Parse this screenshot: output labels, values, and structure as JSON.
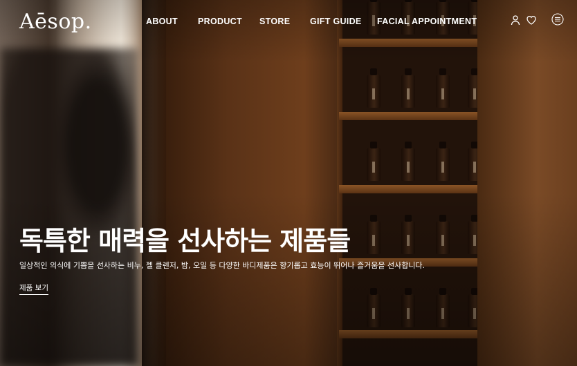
{
  "brand": {
    "logo_text": "Aēsop."
  },
  "nav": {
    "items": [
      {
        "label": "ABOUT"
      },
      {
        "label": "PRODUCT"
      },
      {
        "label": "STORE"
      },
      {
        "label": "GIFT GUIDE"
      },
      {
        "label": "FACIAL APPOINTMENT"
      }
    ]
  },
  "header_icons": [
    "user-icon",
    "heart-icon",
    "menu-icon"
  ],
  "hero": {
    "headline": "독특한 매력을 선사하는 제품들",
    "subline": "일상적인 의식에 기쁨을 선사하는 비누, 젤 클렌저, 밤, 오일 등 다양한 바디제품은 향기롭고 효능이 뛰어나 즐거움을 선사합니다.",
    "cta_label": "제품 보기"
  },
  "colors": {
    "text": "#ffffff",
    "wood": "#6b3f1f",
    "shelf": "#8a5426"
  }
}
